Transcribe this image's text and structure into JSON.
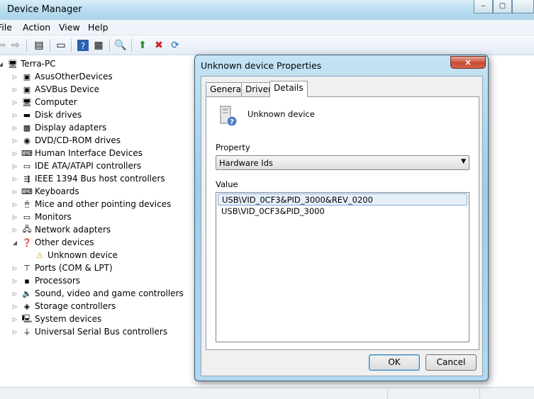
{
  "window": {
    "title": "Device Manager"
  },
  "menu": [
    "File",
    "Action",
    "View",
    "Help"
  ],
  "tree": {
    "root": "Terra-PC",
    "items": [
      {
        "label": "AsusOtherDevices",
        "icon": "device-icon"
      },
      {
        "label": "ASVBus Device",
        "icon": "device-icon"
      },
      {
        "label": "Computer",
        "icon": "computer-icon"
      },
      {
        "label": "Disk drives",
        "icon": "disk-icon"
      },
      {
        "label": "Display adapters",
        "icon": "display-icon"
      },
      {
        "label": "DVD/CD-ROM drives",
        "icon": "dvd-icon"
      },
      {
        "label": "Human Interface Devices",
        "icon": "hid-icon"
      },
      {
        "label": "IDE ATA/ATAPI controllers",
        "icon": "ide-icon"
      },
      {
        "label": "IEEE 1394 Bus host controllers",
        "icon": "firewire-icon"
      },
      {
        "label": "Keyboards",
        "icon": "keyboard-icon"
      },
      {
        "label": "Mice and other pointing devices",
        "icon": "mouse-icon"
      },
      {
        "label": "Monitors",
        "icon": "monitor-icon"
      },
      {
        "label": "Network adapters",
        "icon": "network-icon"
      },
      {
        "label": "Other devices",
        "icon": "other-devices-icon"
      },
      {
        "label": "Unknown device",
        "icon": "warning-icon"
      },
      {
        "label": "Ports (COM & LPT)",
        "icon": "port-icon"
      },
      {
        "label": "Processors",
        "icon": "processor-icon"
      },
      {
        "label": "Sound, video and game controllers",
        "icon": "sound-icon"
      },
      {
        "label": "Storage controllers",
        "icon": "storage-icon"
      },
      {
        "label": "System devices",
        "icon": "system-icon"
      },
      {
        "label": "Universal Serial Bus controllers",
        "icon": "usb-icon"
      }
    ]
  },
  "dialog": {
    "title": "Unknown device Properties",
    "close_label": "×",
    "tabs": [
      "General",
      "Driver",
      "Details"
    ],
    "active_tab": "Details",
    "device_name": "Unknown device",
    "property_label": "Property",
    "property_value": "Hardware Ids",
    "value_label": "Value",
    "values": [
      "USB\\VID_0CF3&PID_3000&REV_0200",
      "USB\\VID_0CF3&PID_3000"
    ],
    "ok_label": "OK",
    "cancel_label": "Cancel"
  }
}
